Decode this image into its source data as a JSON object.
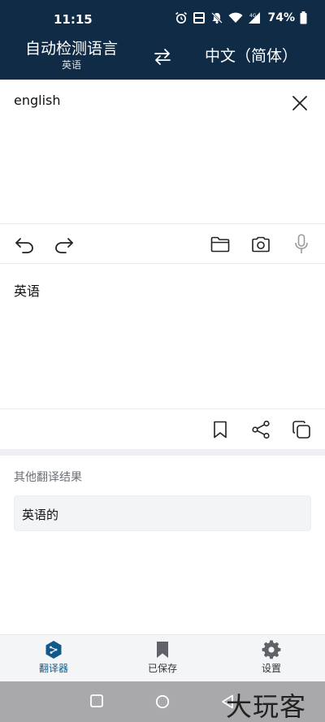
{
  "status": {
    "time": "11:15",
    "battery": "74%",
    "network": "4G"
  },
  "header": {
    "source_lang": "自动检测语言",
    "detected_lang": "英语",
    "target_lang": "中文（简体）"
  },
  "input": {
    "text": "english"
  },
  "output": {
    "text": "英语"
  },
  "alternatives": {
    "title": "其他翻译结果",
    "items": [
      "英语的"
    ]
  },
  "bottom_nav": {
    "translator": "翻译器",
    "saved": "已保存",
    "settings": "设置"
  },
  "watermark": "大玩客",
  "colors": {
    "header_bg": "#0f2b46",
    "accent": "#0f5a8a"
  }
}
